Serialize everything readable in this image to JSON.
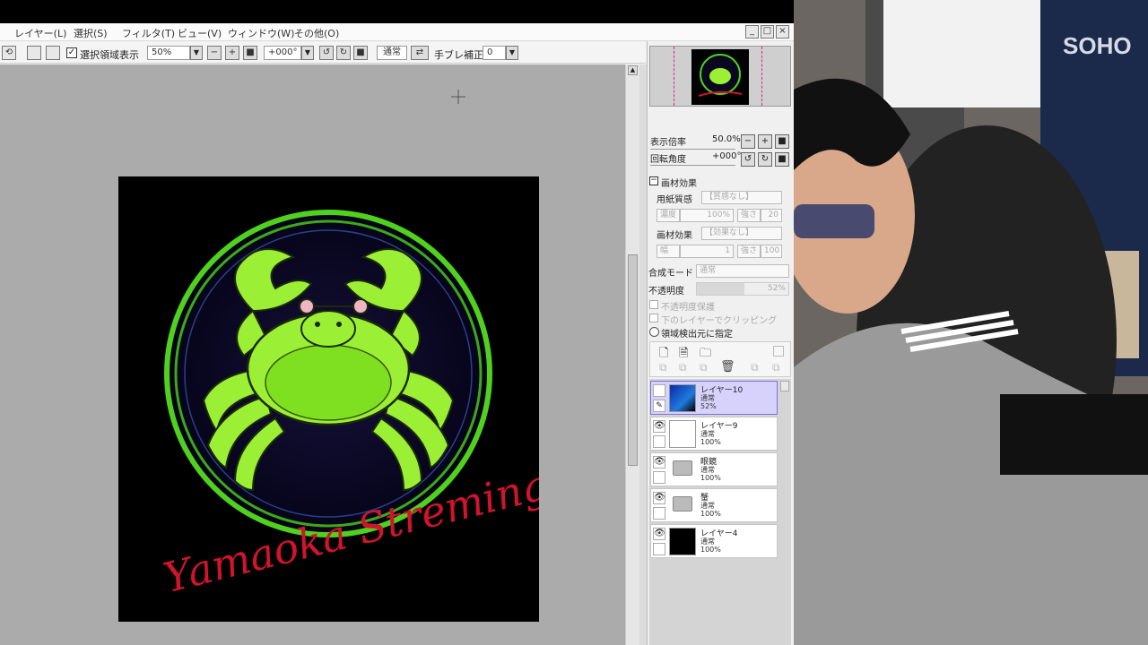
{
  "menu": [
    "レイヤー(L)",
    "選択(S)",
    "フィルタ(T)",
    "ビュー(V)",
    "ウィンドウ(W)",
    "その他(O)"
  ],
  "window_buttons": {
    "minimize": "_",
    "maximize": "□",
    "close": "×"
  },
  "toolbar": {
    "selection_display_label": "選択領域表示",
    "selection_display_checked": true,
    "zoom_value": "50%",
    "rotation_value": "+000°",
    "blend_label": "通常",
    "stabilizer_label": "手ブレ補正",
    "stabilizer_value": "0"
  },
  "canvas_art": {
    "script_text": "Yamaoka Streming"
  },
  "navigator": {
    "zoom_label": "表示倍率",
    "zoom_value": "50.0%",
    "rotate_label": "回転角度",
    "rotate_value": "+000°"
  },
  "brush_effect": {
    "header": "画材効果",
    "paper_label": "用紙質感",
    "paper_value": "【質感なし】",
    "paper_sub_left": "濃度",
    "paper_sub_left_val": "100%",
    "paper_sub_right": "強さ",
    "paper_sub_right_val": "20",
    "effect_label": "画材効果",
    "effect_value": "【効果なし】",
    "effect_sub_left": "幅",
    "effect_sub_left_val": "1",
    "effect_sub_right": "強さ",
    "effect_sub_right_val": "100"
  },
  "layer_props": {
    "blend_mode_label": "合成モード",
    "blend_mode_value": "通常",
    "opacity_label": "不透明度",
    "opacity_value": "52%",
    "opacity_fraction": 0.52,
    "protect_opacity": "不透明度保護",
    "clip_below": "下のレイヤーでクリッピング",
    "region_source": "領域検出元に指定"
  },
  "layers": [
    {
      "name": "レイヤー10",
      "mode": "通常",
      "opacity": "52%",
      "selected": true,
      "kind": "blue"
    },
    {
      "name": "レイヤー9",
      "mode": "通常",
      "opacity": "100%",
      "selected": false,
      "kind": "white"
    },
    {
      "name": "眼鏡",
      "mode": "通常",
      "opacity": "100%",
      "selected": false,
      "kind": "folder"
    },
    {
      "name": "蟹",
      "mode": "通常",
      "opacity": "100%",
      "selected": false,
      "kind": "folder"
    },
    {
      "name": "レイヤー4",
      "mode": "通常",
      "opacity": "100%",
      "selected": false,
      "kind": "black"
    }
  ],
  "colors": {
    "crab_green": "#9bf036",
    "ring_green": "#4fd11e",
    "script_red": "#d0142c",
    "selected_layer": "#d7d2fb"
  },
  "webcam_visible_text": "SOHO"
}
